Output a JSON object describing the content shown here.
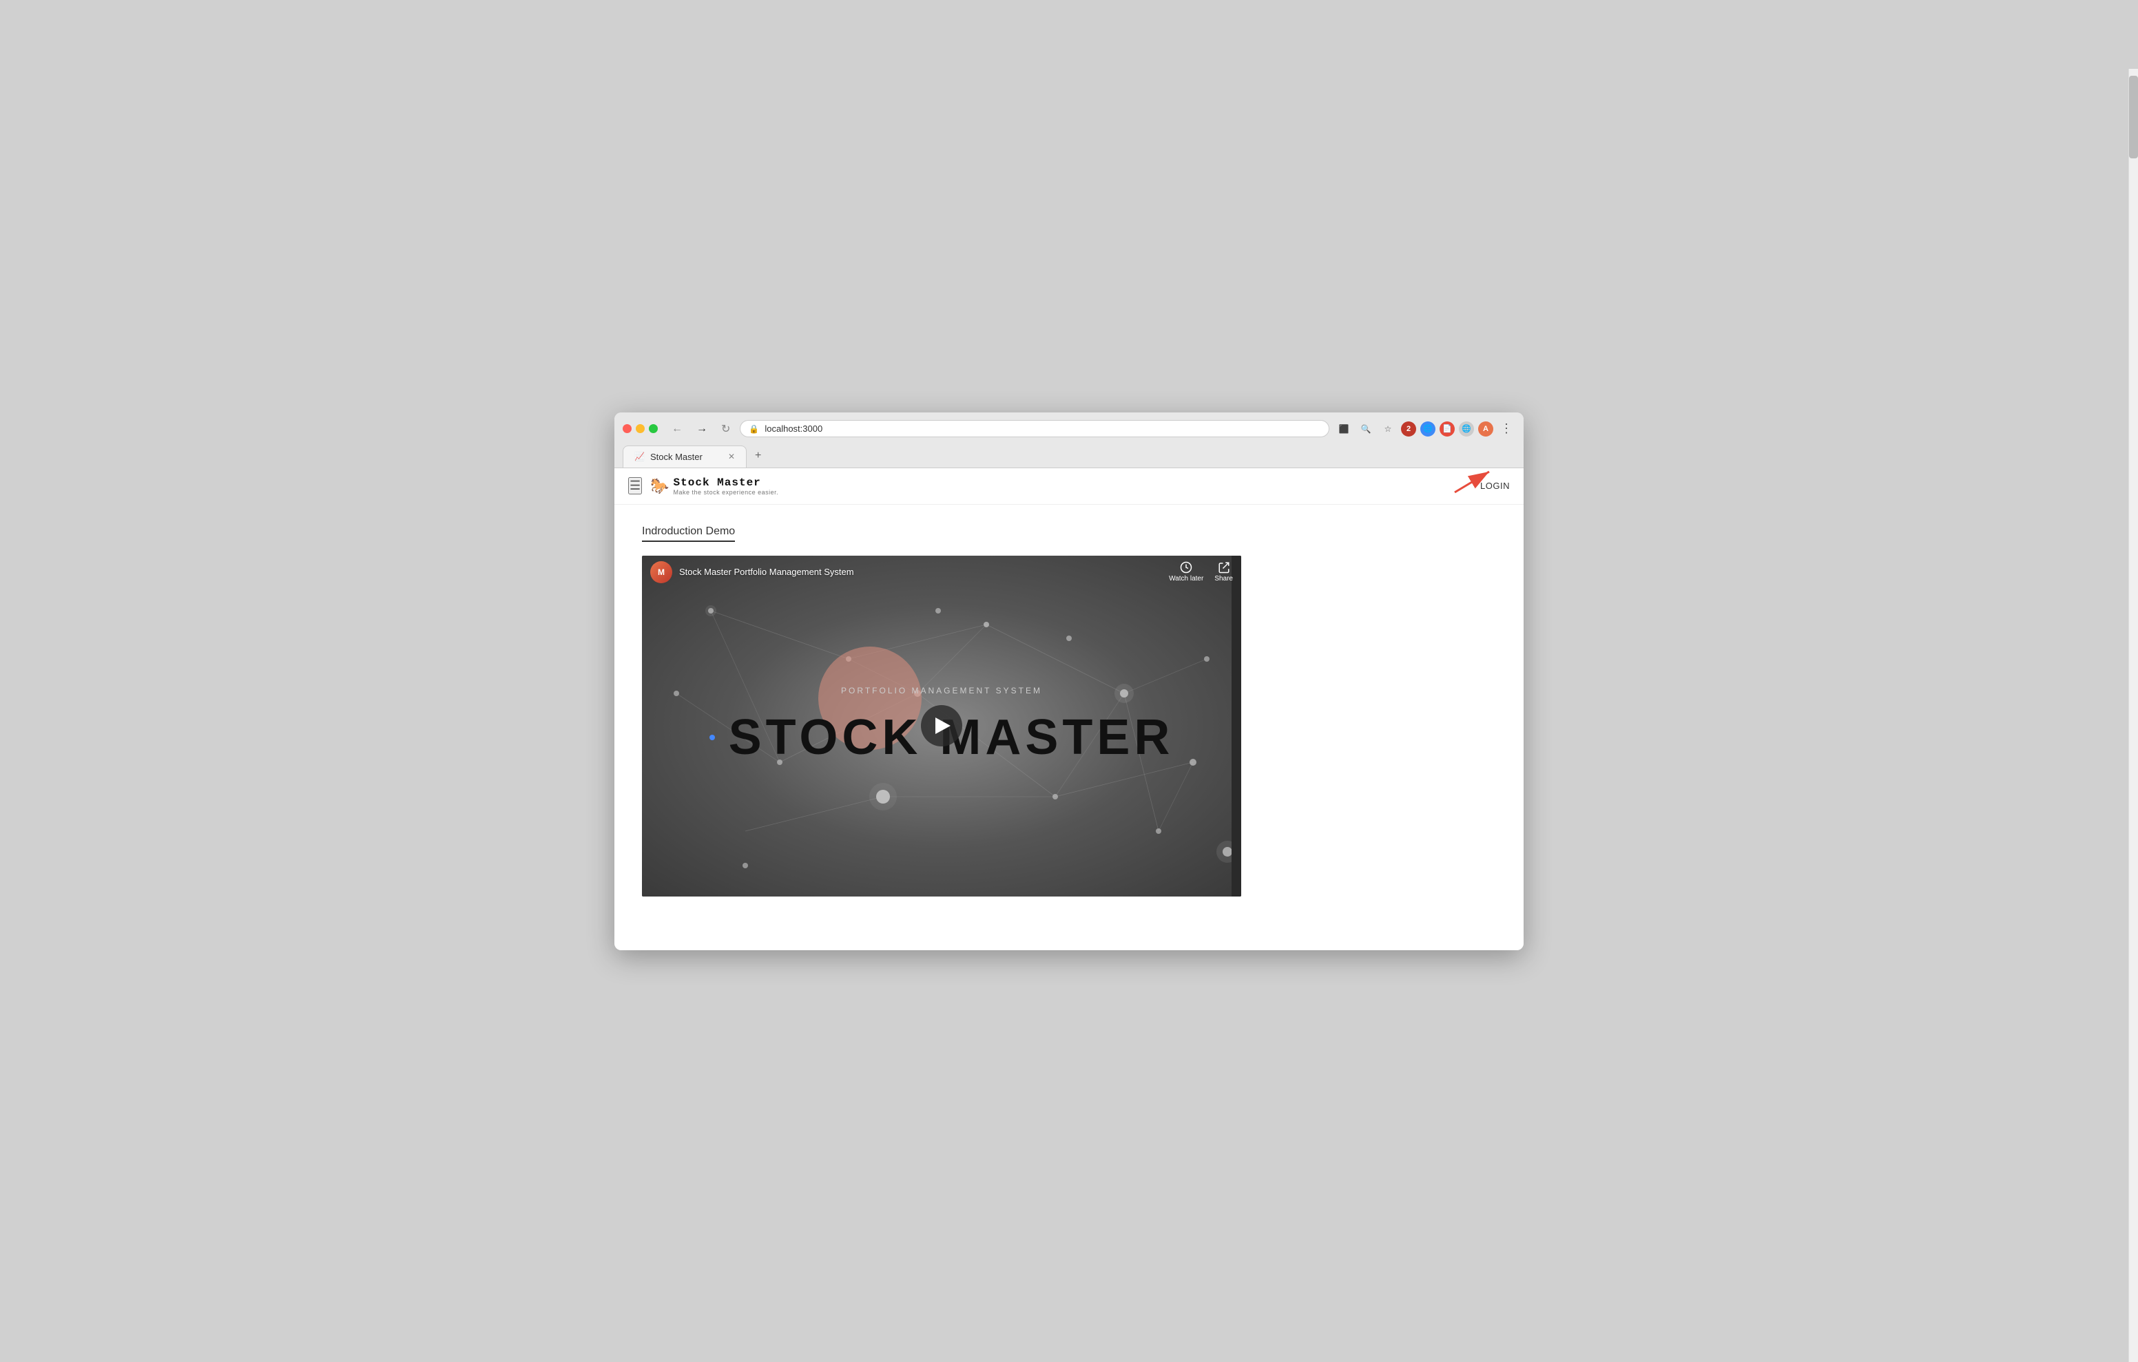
{
  "browser": {
    "url": "localhost:3000",
    "tab_title": "Stock Master",
    "tab_favicon": "📈",
    "new_tab_label": "+"
  },
  "nav_buttons": {
    "back": "←",
    "forward": "→",
    "refresh": "↻",
    "more": "⋮"
  },
  "app": {
    "hamburger": "☰",
    "logo_title": "Stock  Master",
    "logo_subtitle": "Make the stock experience easier.",
    "login_label": "LOGIN"
  },
  "main": {
    "section_title": "Indroduction Demo",
    "video": {
      "channel_avatar_text": "M",
      "title": "Stock Master Portfolio Management System",
      "watch_later_label": "Watch later",
      "share_label": "Share",
      "portfolio_label": "PORTFOLIO MANAGEMENT SYSTEM",
      "stock_master_text": "STOCK MASTER"
    }
  }
}
